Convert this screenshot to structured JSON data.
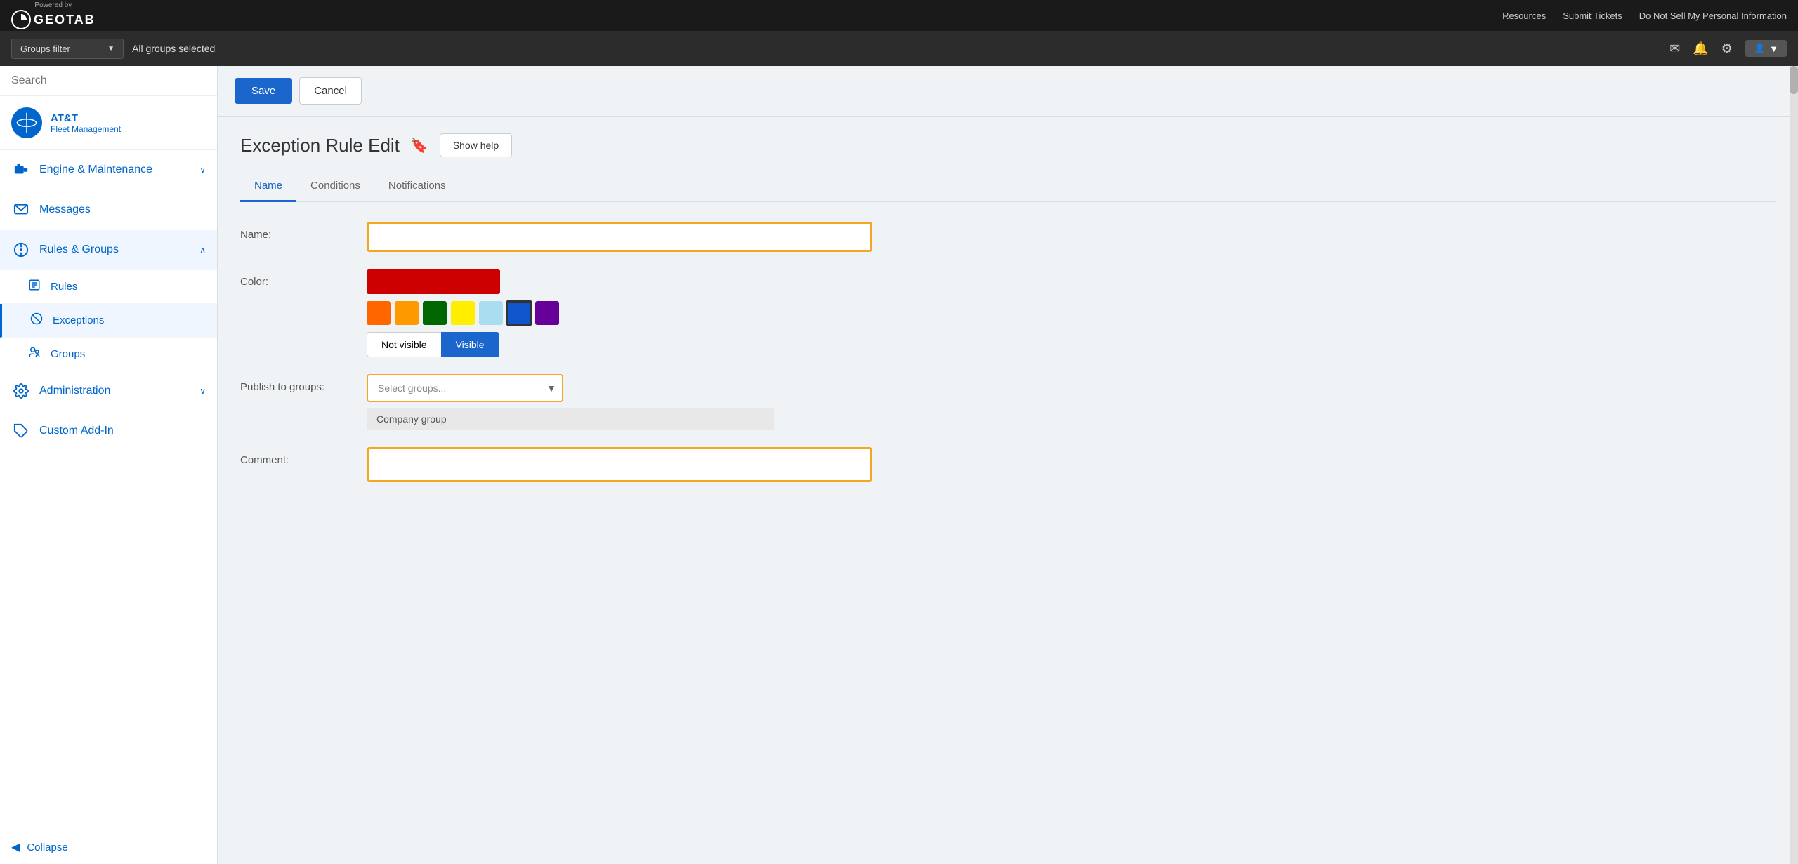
{
  "topbar": {
    "logo_powered": "Powered by",
    "logo_brand": "GEOTAB",
    "links": [
      {
        "label": "Resources",
        "id": "resources-link"
      },
      {
        "label": "Submit Tickets",
        "id": "submit-tickets-link"
      },
      {
        "label": "Do Not Sell My Personal Information",
        "id": "privacy-link"
      }
    ]
  },
  "filterbar": {
    "groups_filter_label": "Groups filter",
    "groups_filter_value": "All groups selected",
    "icons": {
      "mail": "✉",
      "bell": "🔔",
      "gear": "⚙",
      "user": "👤"
    }
  },
  "sidebar": {
    "search_placeholder": "Search",
    "brand": {
      "company": "AT&T",
      "subtitle": "Fleet Management"
    },
    "nav_items": [
      {
        "id": "engine-maintenance",
        "label": "Engine & Maintenance",
        "icon": "🎬",
        "has_arrow": true,
        "expanded": false
      },
      {
        "id": "messages",
        "label": "Messages",
        "icon": "✉",
        "has_arrow": false,
        "expanded": false
      },
      {
        "id": "rules-groups",
        "label": "Rules & Groups",
        "icon": "🎯",
        "has_arrow": true,
        "expanded": true
      }
    ],
    "sub_items": [
      {
        "id": "rules",
        "label": "Rules",
        "icon": "📋"
      },
      {
        "id": "exceptions",
        "label": "Exceptions",
        "icon": "🚫",
        "active": true
      },
      {
        "id": "groups",
        "label": "Groups",
        "icon": "👥"
      }
    ],
    "nav_items_bottom": [
      {
        "id": "administration",
        "label": "Administration",
        "icon": "⚙",
        "has_arrow": true
      },
      {
        "id": "custom-addon",
        "label": "Custom Add-In",
        "icon": "🧩",
        "has_arrow": false
      }
    ],
    "collapse_label": "Collapse"
  },
  "toolbar": {
    "save_label": "Save",
    "cancel_label": "Cancel"
  },
  "page": {
    "title": "Exception Rule Edit",
    "show_help_label": "Show help",
    "tabs": [
      {
        "id": "name",
        "label": "Name",
        "active": true
      },
      {
        "id": "conditions",
        "label": "Conditions",
        "active": false
      },
      {
        "id": "notifications",
        "label": "Notifications",
        "active": false
      }
    ],
    "form": {
      "name_label": "Name:",
      "name_placeholder": "",
      "color_label": "Color:",
      "publish_label": "Publish to groups:",
      "select_groups_placeholder": "Select groups...",
      "company_group_tag": "Company group",
      "comment_label": "Comment:",
      "comment_placeholder": "",
      "colors": [
        {
          "hex": "#cc0000",
          "id": "red",
          "selected": false
        },
        {
          "hex": "#ff6600",
          "id": "orange-red",
          "selected": false
        },
        {
          "hex": "#ff9900",
          "id": "orange",
          "selected": false
        },
        {
          "hex": "#006600",
          "id": "green",
          "selected": false
        },
        {
          "hex": "#ffee00",
          "id": "yellow",
          "selected": false
        },
        {
          "hex": "#aaddee",
          "id": "light-blue",
          "selected": false
        },
        {
          "hex": "#1155cc",
          "id": "blue",
          "selected": true
        },
        {
          "hex": "#660099",
          "id": "purple",
          "selected": false
        }
      ],
      "visibility": {
        "not_visible_label": "Not visible",
        "visible_label": "Visible",
        "current": "visible"
      }
    }
  }
}
